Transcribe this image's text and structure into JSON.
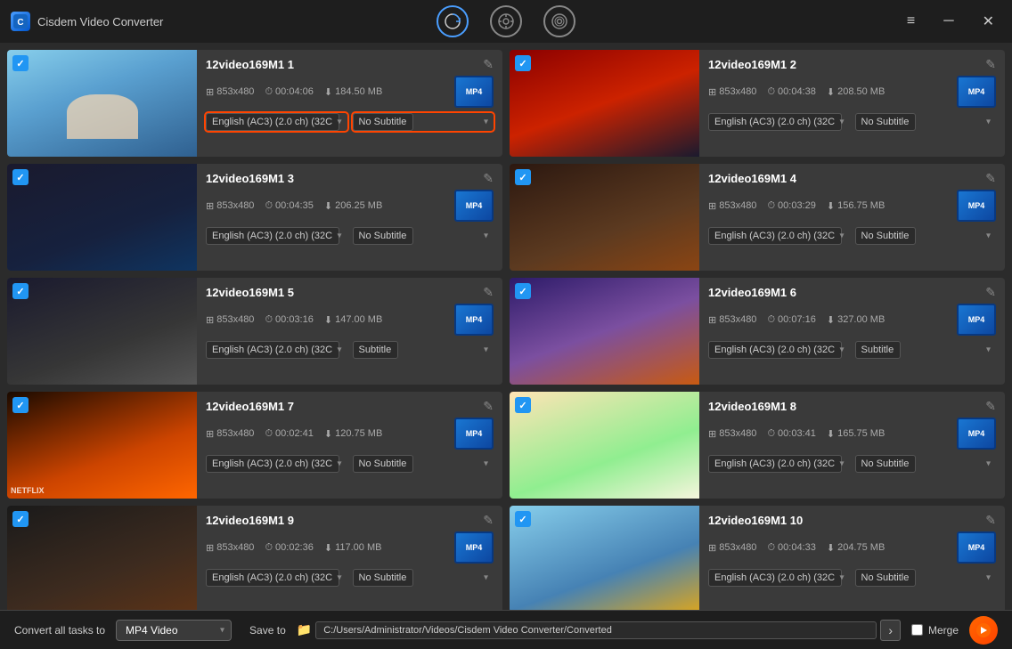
{
  "app": {
    "title": "Cisdem Video Converter",
    "icon_label": "C"
  },
  "titlebar": {
    "icons": [
      {
        "name": "convert-icon",
        "label": "↻",
        "active": true
      },
      {
        "name": "media-icon",
        "label": "⊕",
        "active": false
      },
      {
        "name": "dvd-icon",
        "label": "◎",
        "active": false
      }
    ],
    "controls": {
      "menu_label": "≡",
      "minimize_label": "─",
      "close_label": "✕"
    }
  },
  "videos": [
    {
      "id": 1,
      "title": "12video169M1 1",
      "resolution": "853x480",
      "duration": "00:04:06",
      "size": "184.50 MB",
      "audio": "English (AC3) (2.0 ch) (32C",
      "subtitle": "No Subtitle",
      "thumb_class": "thumb-1",
      "highlighted": true
    },
    {
      "id": 2,
      "title": "12video169M1 2",
      "resolution": "853x480",
      "duration": "00:04:38",
      "size": "208.50 MB",
      "audio": "English (AC3) (2.0 ch) (32C",
      "subtitle": "No Subtitle",
      "thumb_class": "thumb-2",
      "highlighted": false
    },
    {
      "id": 3,
      "title": "12video169M1 3",
      "resolution": "853x480",
      "duration": "00:04:35",
      "size": "206.25 MB",
      "audio": "English (AC3) (2.0 ch) (32C",
      "subtitle": "No Subtitle",
      "thumb_class": "thumb-3",
      "highlighted": false
    },
    {
      "id": 4,
      "title": "12video169M1 4",
      "resolution": "853x480",
      "duration": "00:03:29",
      "size": "156.75 MB",
      "audio": "English (AC3) (2.0 ch) (32C",
      "subtitle": "No Subtitle",
      "thumb_class": "thumb-4",
      "highlighted": false
    },
    {
      "id": 5,
      "title": "12video169M1 5",
      "resolution": "853x480",
      "duration": "00:03:16",
      "size": "147.00 MB",
      "audio": "English (AC3) (2.0 ch) (32C",
      "subtitle": "Subtitle",
      "thumb_class": "thumb-5",
      "highlighted": false
    },
    {
      "id": 6,
      "title": "12video169M1 6",
      "resolution": "853x480",
      "duration": "00:07:16",
      "size": "327.00 MB",
      "audio": "English (AC3) (2.0 ch) (32C",
      "subtitle": "Subtitle",
      "thumb_class": "thumb-6",
      "highlighted": false
    },
    {
      "id": 7,
      "title": "12video169M1 7",
      "resolution": "853x480",
      "duration": "00:02:41",
      "size": "120.75 MB",
      "audio": "English (AC3) (2.0 ch) (32C",
      "subtitle": "No Subtitle",
      "thumb_class": "thumb-7",
      "highlighted": false
    },
    {
      "id": 8,
      "title": "12video169M1 8",
      "resolution": "853x480",
      "duration": "00:03:41",
      "size": "165.75 MB",
      "audio": "English (AC3) (2.0 ch) (32C",
      "subtitle": "No Subtitle",
      "thumb_class": "thumb-8",
      "highlighted": false
    },
    {
      "id": 9,
      "title": "12video169M1 9",
      "resolution": "853x480",
      "duration": "00:02:36",
      "size": "117.00 MB",
      "audio": "English (AC3) (2.0 ch) (32C",
      "subtitle": "No Subtitle",
      "thumb_class": "thumb-9",
      "highlighted": false
    },
    {
      "id": 10,
      "title": "12video169M1 10",
      "resolution": "853x480",
      "duration": "00:04:33",
      "size": "204.75 MB",
      "audio": "English (AC3) (2.0 ch) (32C",
      "subtitle": "No Subtitle",
      "thumb_class": "thumb-10",
      "highlighted": false
    }
  ],
  "bottom_bar": {
    "convert_label": "Convert all tasks to",
    "format_value": "MP4 Video",
    "save_label": "Save to",
    "save_path": "C:/Users/Administrator/Videos/Cisdem Video Converter/Converted",
    "merge_label": "Merge",
    "merge_checked": false
  }
}
